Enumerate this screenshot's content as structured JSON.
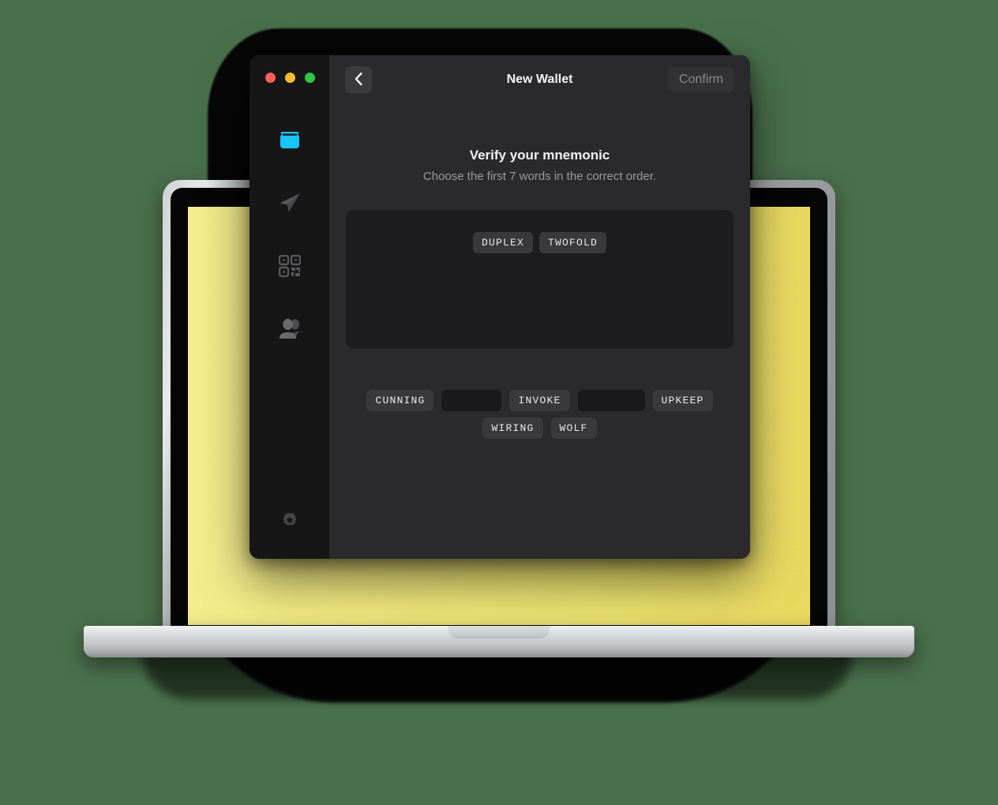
{
  "background": {
    "color": "#4a704b"
  },
  "device": {
    "screen_color": "#f0e476"
  },
  "window": {
    "traffic_lights": [
      {
        "name": "close",
        "color": "#f9605a"
      },
      {
        "name": "minimize",
        "color": "#fcbb2e"
      },
      {
        "name": "maximize",
        "color": "#2bc840"
      }
    ]
  },
  "sidebar": {
    "items": [
      {
        "icon": "wallet-icon",
        "label": "Wallet",
        "active": true,
        "color": "#17c3f7"
      },
      {
        "icon": "send-icon",
        "label": "Send",
        "active": false,
        "color": "#58585c"
      },
      {
        "icon": "qr-code-icon",
        "label": "Receive",
        "active": false,
        "color": "#58585c"
      },
      {
        "icon": "contacts-icon",
        "label": "Contacts",
        "active": false,
        "color": "#58585c"
      }
    ],
    "settings": {
      "icon": "gear-icon",
      "label": "Settings",
      "color": "#3a3a3c"
    }
  },
  "titlebar": {
    "back_label": "‹",
    "title": "New Wallet",
    "confirm_label": "Confirm",
    "confirm_disabled": true
  },
  "content": {
    "heading": "Verify your mnemonic",
    "subheading": "Choose the first 7 words in the correct order.",
    "required_word_count": 7,
    "selected_words": [
      "DUPLEX",
      "TWOFOLD"
    ],
    "word_bank": [
      {
        "label": "CUNNING",
        "used": false
      },
      {
        "label": "DUPLEX",
        "used": true
      },
      {
        "label": "INVOKE",
        "used": false
      },
      {
        "label": "TWOFOLD",
        "used": true
      },
      {
        "label": "UPKEEP",
        "used": false
      },
      {
        "label": "WIRING",
        "used": false
      },
      {
        "label": "WOLF",
        "used": false
      }
    ]
  }
}
